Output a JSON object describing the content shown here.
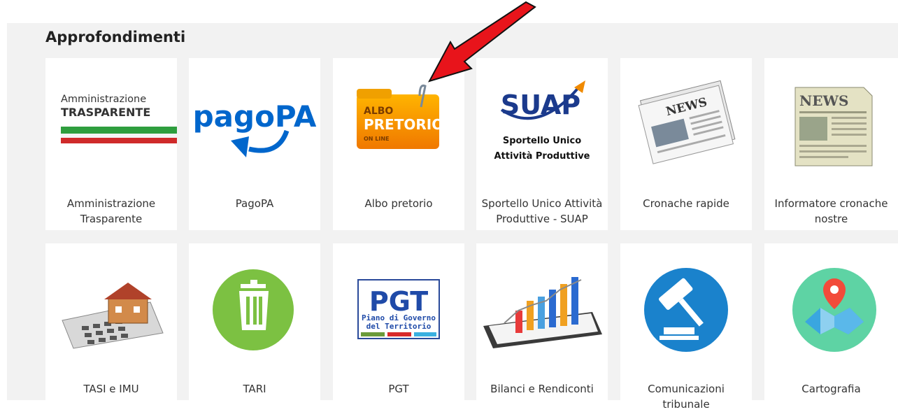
{
  "section": {
    "title": "Approfondimenti"
  },
  "cards": [
    {
      "label": "Amministrazione Trasparente",
      "logo_line1": "Amministrazione",
      "logo_line2": "TRASPARENTE"
    },
    {
      "label": "PagoPA",
      "logo_text": "pagoPA"
    },
    {
      "label": "Albo pretorio",
      "logo_line1": "ALBO",
      "logo_line2": "PRETORIO",
      "logo_line3": "ON LINE"
    },
    {
      "label": "Sportello Unico Attività Produttive - SUAP",
      "logo_text": "SUAP",
      "logo_line1": "Sportello Unico",
      "logo_line2": "Attività Produttive"
    },
    {
      "label": "Cronache rapide",
      "logo_text": "NEWS"
    },
    {
      "label": "Informatore cronache nostre",
      "logo_text": "NEWS"
    },
    {
      "label": "TASI e IMU"
    },
    {
      "label": "TARI"
    },
    {
      "label": "PGT",
      "logo_text": "PGT",
      "logo_line1": "Piano di Governo",
      "logo_line2": "del Territorio"
    },
    {
      "label": "Bilanci e Rendiconti"
    },
    {
      "label": "Comunicazioni tribunale"
    },
    {
      "label": "Cartografia"
    }
  ],
  "colors": {
    "section_bg": "#f2f2f2",
    "card_bg": "#ffffff",
    "pagopa_blue": "#0066cc",
    "arrow_red": "#e8141b",
    "tari_green": "#7cc142",
    "tribunale_blue": "#1a82cc",
    "map_green": "#5ed3a4"
  }
}
